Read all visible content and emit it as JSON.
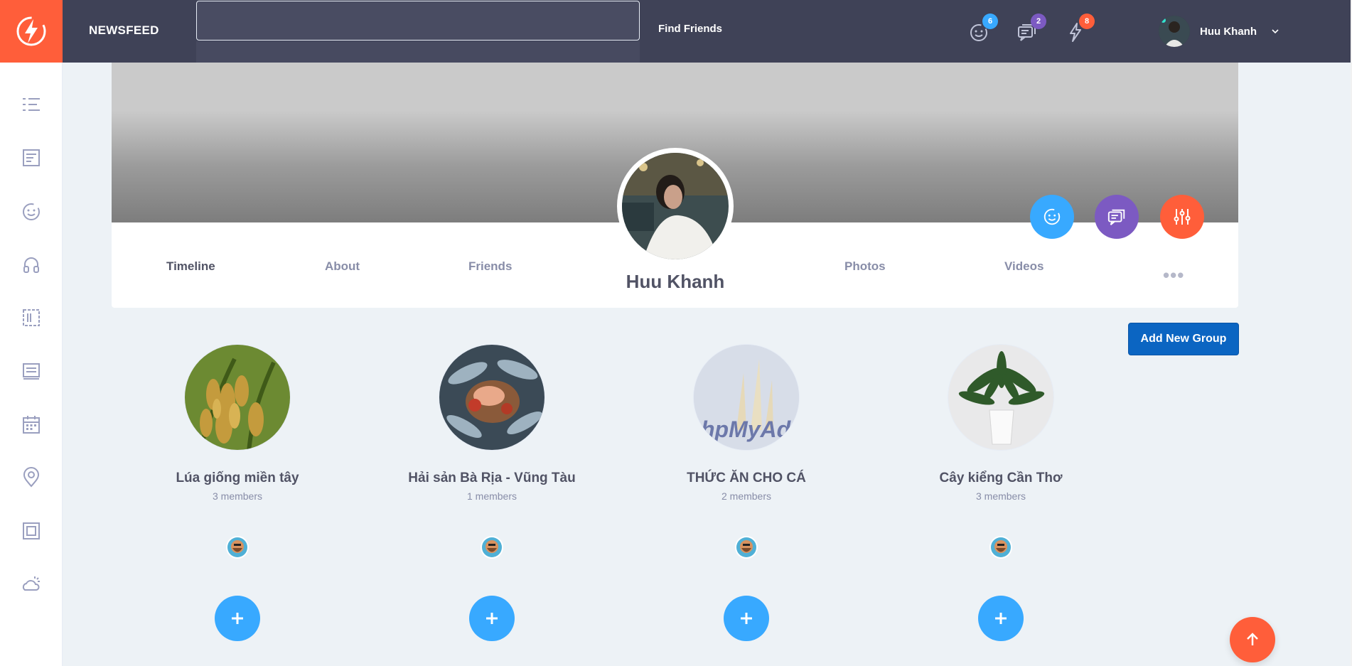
{
  "header": {
    "brand": "NEWSFEED",
    "search_placeholder": "",
    "find_friends": "Find Friends",
    "badges": {
      "friend_requests": "6",
      "messages": "2",
      "notifications": "8"
    },
    "user_name": "Huu Khanh"
  },
  "sidebar": {
    "items": [
      "collapse-menu-icon",
      "newsfeed-icon",
      "fav-pages-icon",
      "music-icon",
      "weather-widget-icon",
      "badges-icon",
      "calendar-icon",
      "location-icon",
      "stats-icon",
      "weather-icon"
    ]
  },
  "profile": {
    "name": "Huu Khanh",
    "tabs": [
      "Timeline",
      "About",
      "Friends",
      "Photos",
      "Videos"
    ],
    "more": "•••",
    "active_tab": "Timeline"
  },
  "groups": {
    "add_button": "Add New Group",
    "items": [
      {
        "name": "Lúa giống miền tây",
        "members": "3 members"
      },
      {
        "name": "Hải sản Bà Rịa - Vũng Tàu",
        "members": "1 members"
      },
      {
        "name": "THỨC ĂN CHO CÁ",
        "members": "2 members"
      },
      {
        "name": "Cây kiểng Cần Thơ",
        "members": "3 members"
      }
    ],
    "placeholder_logo_text": "hpMyAdmin"
  },
  "colors": {
    "topbar": "#3f4257",
    "accent_orange": "#ff5e3a",
    "blue": "#38a9ff",
    "purple": "#7c5ac2",
    "primary_button": "#0b65c2",
    "badge_blue": "#38a9ff",
    "badge_purple": "#7c5ac2",
    "badge_orange": "#ff5e3a"
  }
}
